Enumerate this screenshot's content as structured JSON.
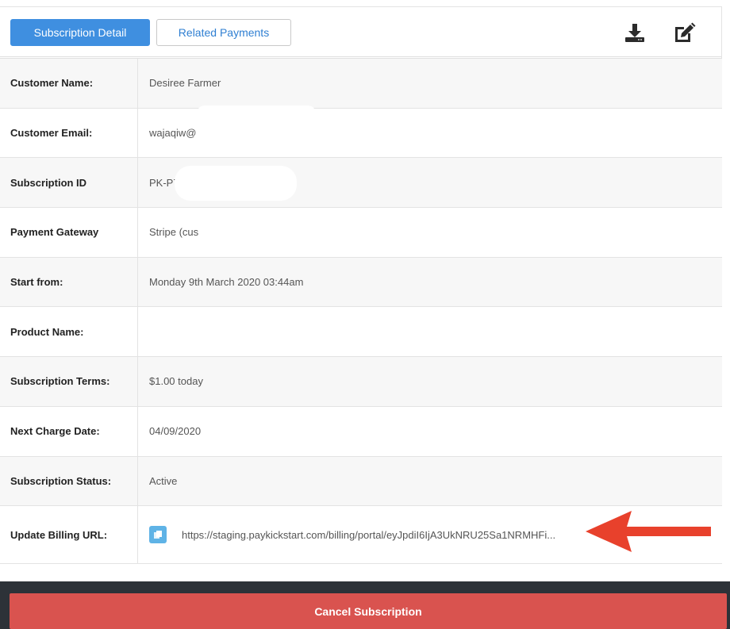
{
  "tabs": {
    "active_label": "Subscription Detail",
    "inactive_label": "Related Payments"
  },
  "icons": {
    "download": "download-icon",
    "edit": "edit-icon",
    "copy": "copy-icon"
  },
  "rows": [
    {
      "label": "Customer Name:",
      "value": "Desiree Farmer"
    },
    {
      "label": "Customer Email:",
      "value": "wajaqiw@"
    },
    {
      "label": "Subscription ID",
      "value": "PK-P7"
    },
    {
      "label": "Payment Gateway",
      "value": "Stripe (cus"
    },
    {
      "label": "Start from:",
      "value": "Monday 9th March 2020 03:44am"
    },
    {
      "label": "Product Name:",
      "value": ""
    },
    {
      "label": "Subscription Terms:",
      "value": "$1.00 today"
    },
    {
      "label": "Next Charge Date:",
      "value": "04/09/2020"
    },
    {
      "label": "Subscription Status:",
      "value": "Active"
    },
    {
      "label": "Update Billing URL:",
      "value": "https://staging.paykickstart.com/billing/portal/eyJpdiI6IjA3UkNRU25Sa1NRMHFi..."
    }
  ],
  "footer": {
    "cancel_label": "Cancel Subscription"
  },
  "colors": {
    "primary": "#3f8fe0",
    "danger": "#d9534f",
    "arrow": "#e8412c",
    "footer_bg": "#2d3238"
  }
}
